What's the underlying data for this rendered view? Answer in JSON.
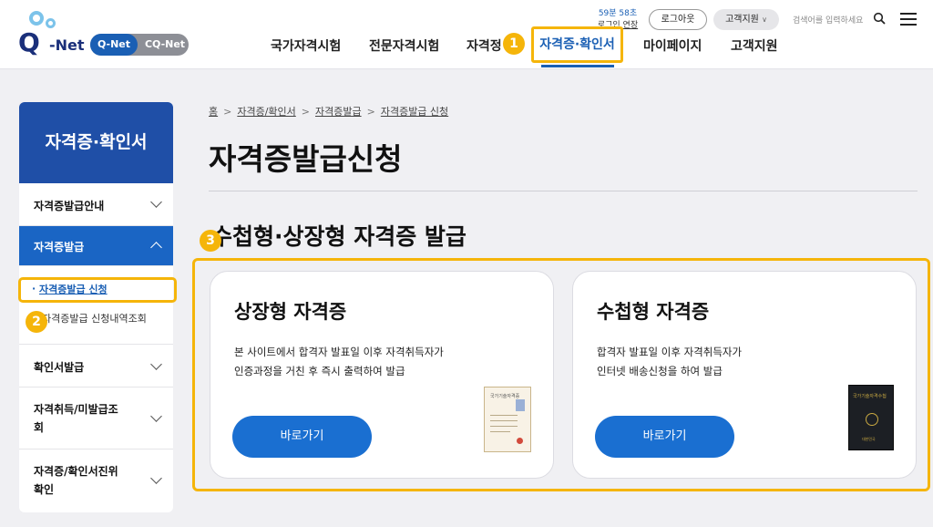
{
  "header": {
    "logo_q": "Q",
    "logo_net": "-Net",
    "switch": {
      "active": "Q-Net",
      "inactive": "CQ-Net"
    },
    "timer": {
      "remaining": "59분 58초",
      "extend": "로그인 연장"
    },
    "logout": "로그아웃",
    "support": "고객지원",
    "search_placeholder": "검색어를 입력하세요",
    "nav": {
      "item1": "국가자격시험",
      "item2": "전문자격시험",
      "item3": "자격정",
      "active": "자격증·확인서",
      "item5": "마이페이지",
      "item6": "고객지원"
    }
  },
  "markers": {
    "m1": "1",
    "m2": "2",
    "m3": "3"
  },
  "sidebar": {
    "title": "자격증·확인서",
    "items": {
      "guide": "자격증발급안내",
      "issue": "자격증발급",
      "apply": "자격증발급 신청",
      "history": "자격증발급 신청내역조회",
      "confirm": "확인서발급",
      "status_l1": "자격취득/미발급조",
      "status_l2": "회",
      "verify_l1": "자격증/확인서진위",
      "verify_l2": "확인"
    }
  },
  "breadcrumb": {
    "home": "홈",
    "c1": "자격증/확인서",
    "c2": "자격증발급",
    "c3": "자격증발급 신청"
  },
  "page_title": "자격증발급신청",
  "section_title": "수첩형·상장형 자격증 발급",
  "cards": {
    "left": {
      "title": "상장형 자격증",
      "desc1": "본 사이트에서 합격자 발표일 이후 자격취득자가",
      "desc2": "인증과정을 거친 후 즉시 출력하여 발급",
      "button": "바로가기",
      "image_text": "국가기술자격증"
    },
    "right": {
      "title": "수첩형 자격증",
      "desc1": "합격자 발표일 이후 자격취득자가",
      "desc2": "인터넷 배송신청을 하여 발급",
      "button": "바로가기",
      "image_text": "국가기술자격수첩",
      "image_sub": "대한민국"
    }
  },
  "colors": {
    "accent": "#1a5fb4",
    "highlight": "#f5b50a",
    "sidebar_title_bg": "#1f4fa7"
  }
}
